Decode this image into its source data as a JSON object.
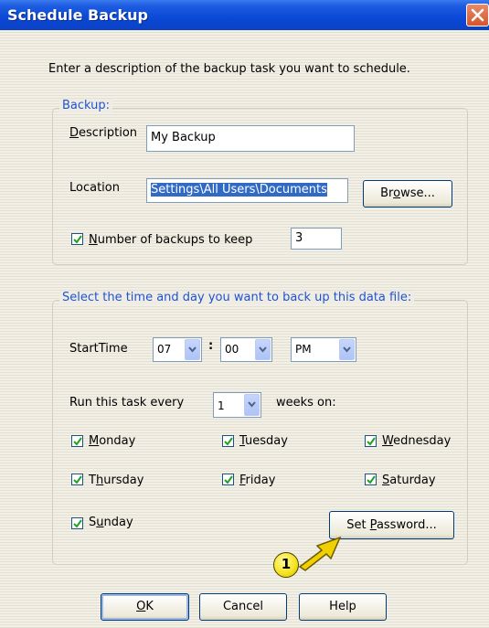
{
  "dialog": {
    "title": "Schedule Backup",
    "intro": "Enter a description of the backup task you want to schedule."
  },
  "backup_group": {
    "title": "Backup:",
    "description_label": "Description",
    "description_value": "My Backup",
    "location_label": "Location",
    "location_value": "Settings\\All Users\\Documents",
    "browse_label": "Browse...",
    "keep_label": "Number of backups to keep",
    "keep_checked": true,
    "keep_value": "3"
  },
  "schedule_group": {
    "title": "Select the time and day you want to back up this data file:",
    "start_time_label": "StartTime",
    "hour": "07",
    "time_separator": ":",
    "minute": "00",
    "ampm": "PM",
    "run_every_label": "Run this task every",
    "weeks_value": "1",
    "weeks_on_label": "weeks on:",
    "days": [
      {
        "label": "Monday",
        "checked": true
      },
      {
        "label": "Tuesday",
        "checked": true
      },
      {
        "label": "Wednesday",
        "checked": true
      },
      {
        "label": "Thursday",
        "checked": true
      },
      {
        "label": "Friday",
        "checked": true
      },
      {
        "label": "Saturday",
        "checked": true
      },
      {
        "label": "Sunday",
        "checked": true
      }
    ],
    "set_password_label": "Set Password..."
  },
  "callout": {
    "number": "1",
    "badge_color": "#f5e21a",
    "arrow_color": "#f0d000"
  },
  "buttons": {
    "ok": "OK",
    "cancel": "Cancel",
    "help": "Help"
  },
  "colors": {
    "title_bar": "#0a48d6",
    "group_title": "#1e52d6",
    "close_button": "#d8542c"
  }
}
